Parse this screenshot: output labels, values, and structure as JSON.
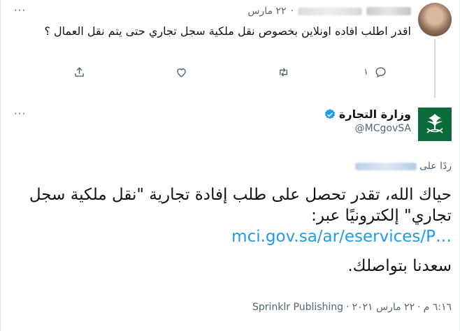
{
  "reply_tweet": {
    "date": "٢٢ مارس",
    "text": "اقدر اطلب افاده اونلاين بخصوص نقل ملكية سجل تجاري حتى يتم نقل العمال ؟",
    "reply_count": "١",
    "more_label": "···"
  },
  "main_tweet": {
    "display_name": "وزارة التجارة",
    "handle": "@MCgovSA",
    "more_label": "···",
    "replying_to_label": "ردًا على",
    "body_line1": "حياك الله، تقدر تحصل على طلب إفادة تجارية \"نقل ملكية سجل تجاري\" إلكترونيًا عبر:",
    "link_text": "mci.gov.sa/ar/eservices/P…",
    "closing": "سعدنا بتواصلك.",
    "time": "٦:١٦ م",
    "date": "٢٢ مارس ٢٠٢١",
    "source": "Sprinklr Publishing"
  },
  "colors": {
    "accent": "#1d9bf0",
    "muted": "#536471",
    "logo_bg": "#0b6b3a"
  },
  "icons": [
    "reply-icon",
    "retweet-icon",
    "like-icon",
    "share-icon",
    "verified-icon",
    "saudi-emblem-icon"
  ]
}
